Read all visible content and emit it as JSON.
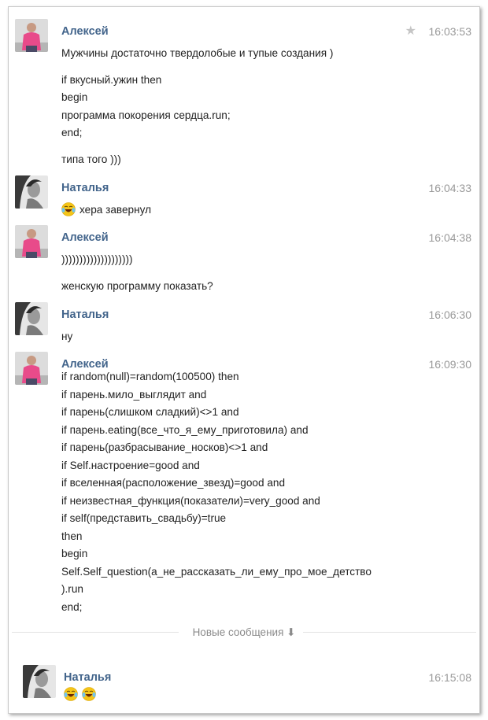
{
  "messages": [
    {
      "author": "Алексей",
      "time": "16:03:53",
      "starred": true,
      "avatar_icon": "man-pink-shirt-avatar",
      "paragraphs": [
        [
          "Мужчины достаточно твердолобые и тупые создания )"
        ],
        [
          "if вкусный.ужин then",
          "begin",
          "программа покорения сердца.run;",
          "end;"
        ],
        [
          "типа того )))"
        ]
      ]
    },
    {
      "author": "Наталья",
      "time": "16:04:33",
      "avatar_icon": "woman-portrait-avatar",
      "emoji": "laughing-tears-emoji",
      "paragraphs": [
        [
          "хера завернул"
        ]
      ]
    },
    {
      "author": "Алексей",
      "time": "16:04:38",
      "avatar_icon": "man-pink-shirt-avatar",
      "paragraphs": [
        [
          "))))))))))))))))))))"
        ],
        [
          "женскую программу показать?"
        ]
      ]
    },
    {
      "author": "Наталья",
      "time": "16:06:30",
      "avatar_icon": "woman-portrait-avatar",
      "paragraphs": [
        [
          "ну"
        ]
      ]
    },
    {
      "author": "Алексей",
      "time": "16:09:30",
      "avatar_icon": "man-pink-shirt-avatar",
      "paragraphs": [
        [
          "if random(null)=random(100500) then",
          "if парень.мило_выглядит and",
          "if парень(слишком сладкий)<>1 and",
          "if парень.eating(все_что_я_ему_приготовила) and",
          "if парень(разбрасывание_носков)<>1 and",
          "if Self.настроение=good and",
          "if вселенная(расположение_звезд)=good and",
          "if неизвестная_функция(показатели)=very_good and",
          "if self(представить_свадьбу)=true",
          "then",
          "begin",
          "Self.Self_question(а_не_рассказать_ли_ему_про_мое_детство",
          ").run",
          "end;"
        ]
      ]
    },
    {
      "author": "Наталья",
      "time": "16:15:08",
      "avatar_icon": "woman-portrait-avatar",
      "emoji_count": 2,
      "emoji": "laughing-tears-emoji",
      "paragraphs": []
    }
  ],
  "divider": {
    "label": "Новые сообщения ⬇"
  },
  "colors": {
    "author": "#42648b",
    "time": "#999999",
    "text": "#222222",
    "divider": "#8a8a8a"
  }
}
